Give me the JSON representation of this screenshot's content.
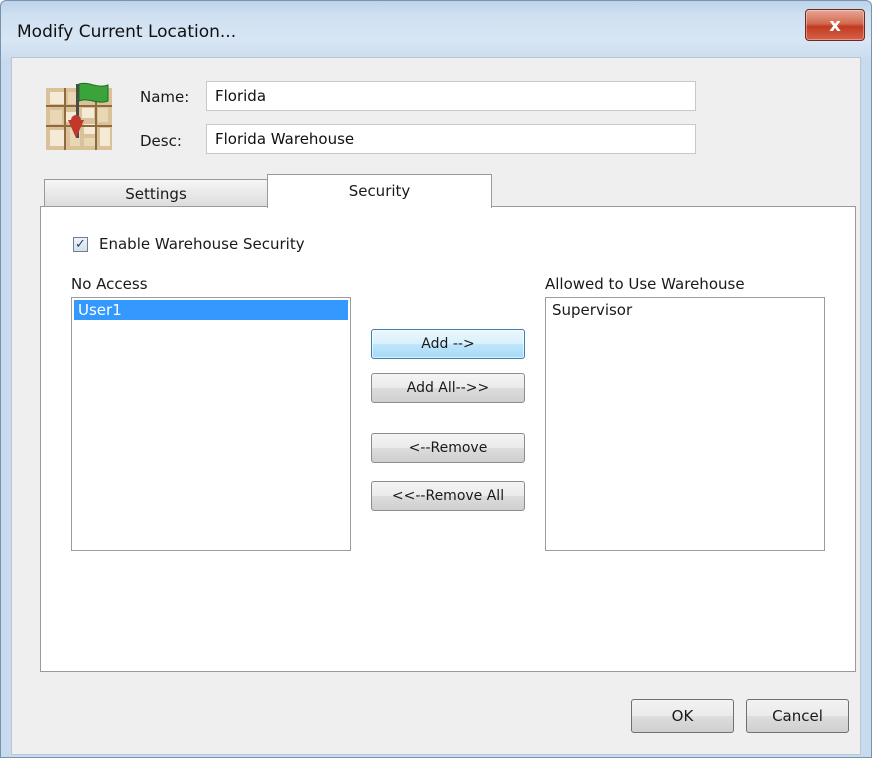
{
  "window": {
    "title": "Modify Current Location...",
    "close_glyph": "x"
  },
  "icons": {
    "app_icon": "map-flag-icon",
    "close": "close-icon",
    "check": "checkmark-icon"
  },
  "header": {
    "name_label": "Name:",
    "name_value": "Florida",
    "desc_label": "Desc:",
    "desc_value": "Florida Warehouse"
  },
  "tabs": [
    {
      "label": "Settings",
      "active": false
    },
    {
      "label": "Security",
      "active": true
    }
  ],
  "security": {
    "enable_label": "Enable Warehouse Security",
    "enable_checked": true,
    "check_glyph": "✓",
    "no_access": {
      "label": "No Access",
      "items": [
        "User1"
      ],
      "selected_index": 0
    },
    "allowed": {
      "label": "Allowed to Use Warehouse",
      "items": [
        "Supervisor"
      ]
    },
    "buttons": {
      "add": "Add -->",
      "add_all": "Add All-->>",
      "remove": "<--Remove",
      "remove_all": "<<--Remove All"
    }
  },
  "footer": {
    "ok": "OK",
    "cancel": "Cancel"
  },
  "colors": {
    "selection": "#3399ff",
    "close_button": "#c03b20",
    "focused_button_border": "#3c7fb1"
  }
}
